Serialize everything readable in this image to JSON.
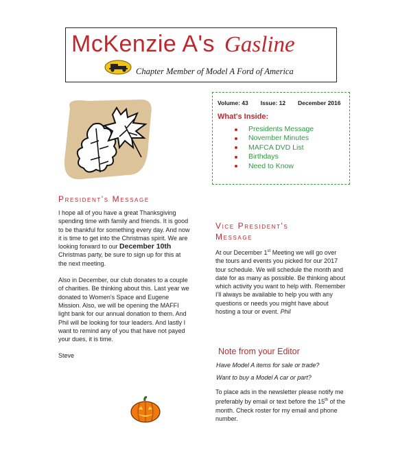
{
  "masthead": {
    "title_main": "McKenzie A's",
    "title_accent": "Gasline",
    "tagline": "Chapter Member of Model A Ford of America"
  },
  "infobox": {
    "volume": "Volume: 43",
    "issue": "Issue: 12",
    "date": "December 2016",
    "inside_heading": "What's Inside:",
    "items": [
      "Presidents Message",
      "November Minutes",
      "MAFCA DVD List",
      "Birthdays",
      "Need to Know"
    ]
  },
  "president": {
    "heading": "President's Message",
    "p1_a": "I hope all of you have a great Thanksgiving spending time with family and friends.  It is good to be thankful for something every day.  And now it is time to get into the Christmas spirit.  We are looking forward to our ",
    "p1_bold": "December 10th",
    "p1_b": " Christmas party, be sure to sign up for this at the next meeting.",
    "p2": "Also in December, our club donates to a couple of charities.  Be thinking about this.  Last year we donated to Women's Space and Eugene Mission.  Also, we will be opening the MAFFI light bank for our annual donation to them.  And Phil will be looking for tour leaders.  And lastly I want to remind any of you that have not payed your dues, it is time.",
    "signoff": "Steve"
  },
  "vice_president": {
    "heading_l1": "Vice President's",
    "heading_l2": "Message",
    "text_a": "At our December 1",
    "text_sup": "st",
    "text_b": " Meeting we will go over the tours and events you picked for our 2017 tour schedule.  We will schedule the month and date for as many as possible.  Be thinking about which activity you want to help with.  Remember  I'll always be available to help you with any questions or needs you might have about hosting a tour or event.  ",
    "signature": "Phil"
  },
  "editor": {
    "heading": "Note from your Editor",
    "q1": "Have Model A items for sale or trade?",
    "q2": "Want to buy a Model A car or part?",
    "text_a": "To place ads in the newsletter please notify me preferably by email or text before the 15",
    "text_sup": "th",
    "text_b": " of the month.  Check roster for my email and phone number."
  },
  "colors": {
    "accent_red": "#c0272d",
    "list_green": "#2e9a42",
    "leaf_tan": "#dcc39a"
  }
}
